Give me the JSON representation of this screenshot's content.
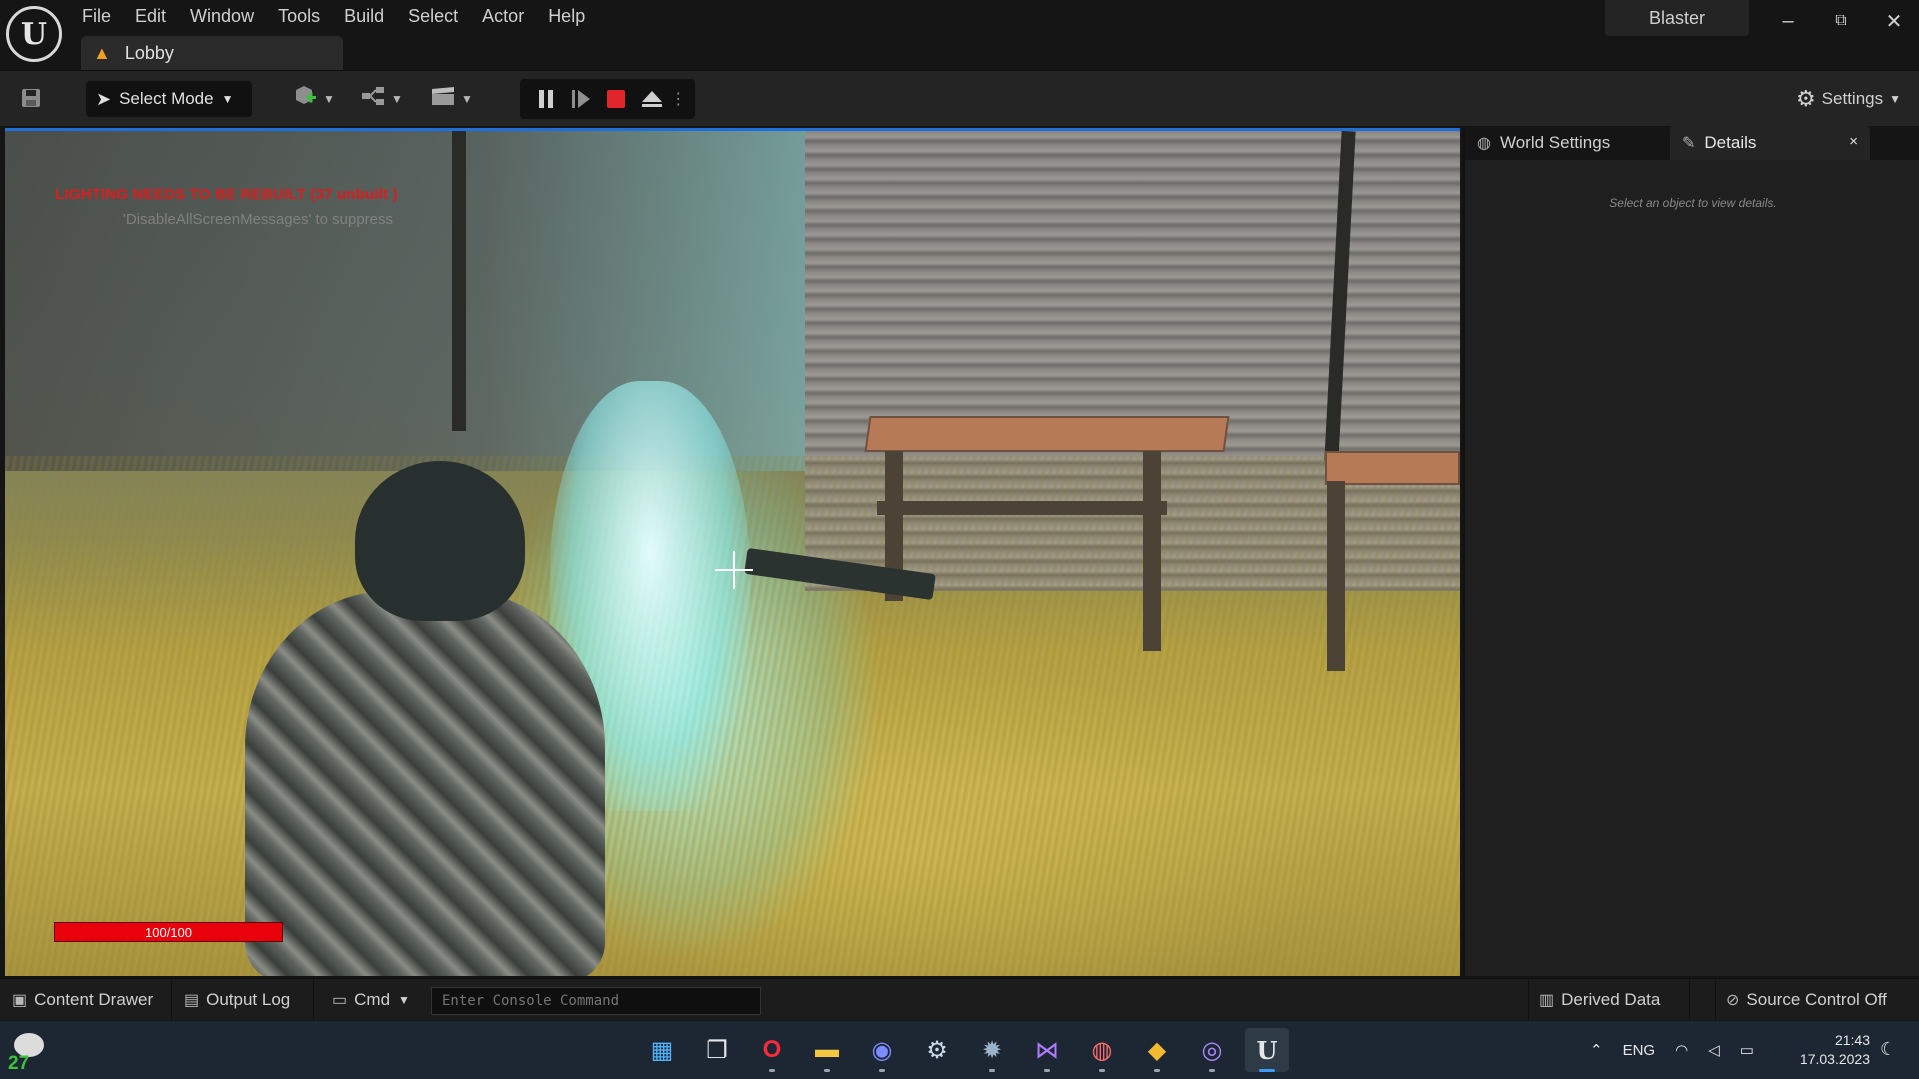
{
  "menu": {
    "items": [
      {
        "label": "File"
      },
      {
        "label": "Edit"
      },
      {
        "label": "Window"
      },
      {
        "label": "Tools"
      },
      {
        "label": "Build"
      },
      {
        "label": "Select"
      },
      {
        "label": "Actor"
      },
      {
        "label": "Help"
      }
    ]
  },
  "document_tab": {
    "label": "Lobby",
    "icon": "level-warning-icon"
  },
  "project": {
    "name": "Blaster"
  },
  "window_controls": {
    "minimize": "–",
    "restore": "⧉",
    "close": "✕"
  },
  "toolbar": {
    "select_mode_label": "Select Mode",
    "settings_label": "Settings",
    "play_controls": [
      "pause",
      "resume",
      "stop",
      "eject"
    ],
    "stop_color": "#e0262a"
  },
  "viewport": {
    "lighting_warning": "LIGHTING NEEDS TO BE REBUILT (37 unbuilt )",
    "suppress_hint": "'DisableAllScreenMessages' to suppress",
    "health_text": "100/100",
    "health_fraction": 1.0,
    "health_color": "#e8000b"
  },
  "right_panel": {
    "tabs": [
      {
        "label": "World Settings",
        "icon": "globe-icon"
      },
      {
        "label": "Details",
        "icon": "pencil-icon"
      }
    ],
    "close": "×",
    "hint": "Select an object to view details."
  },
  "statusbar": {
    "content_drawer": "Content Drawer",
    "output_log": "Output Log",
    "cmd_label": "Cmd",
    "console_placeholder": "Enter Console Command",
    "derived_data": "Derived Data",
    "source_control": "Source Control Off"
  },
  "taskbar": {
    "weather_temp": "27",
    "apps": [
      {
        "name": "windows-start",
        "glyph": "▦"
      },
      {
        "name": "task-view",
        "glyph": "❐"
      },
      {
        "name": "opera-browser",
        "glyph": "O"
      },
      {
        "name": "file-explorer",
        "glyph": "▬"
      },
      {
        "name": "discord",
        "glyph": "◉"
      },
      {
        "name": "steam",
        "glyph": "⚙"
      },
      {
        "name": "settings",
        "glyph": "✹"
      },
      {
        "name": "visual-studio",
        "glyph": "⋈"
      },
      {
        "name": "app-generic",
        "glyph": "◍"
      },
      {
        "name": "binance",
        "glyph": "◆"
      },
      {
        "name": "github-desktop",
        "glyph": "◎"
      },
      {
        "name": "unreal-engine",
        "glyph": "U"
      }
    ],
    "language": "ENG",
    "time": "21:43",
    "date": "17.03.2023"
  }
}
